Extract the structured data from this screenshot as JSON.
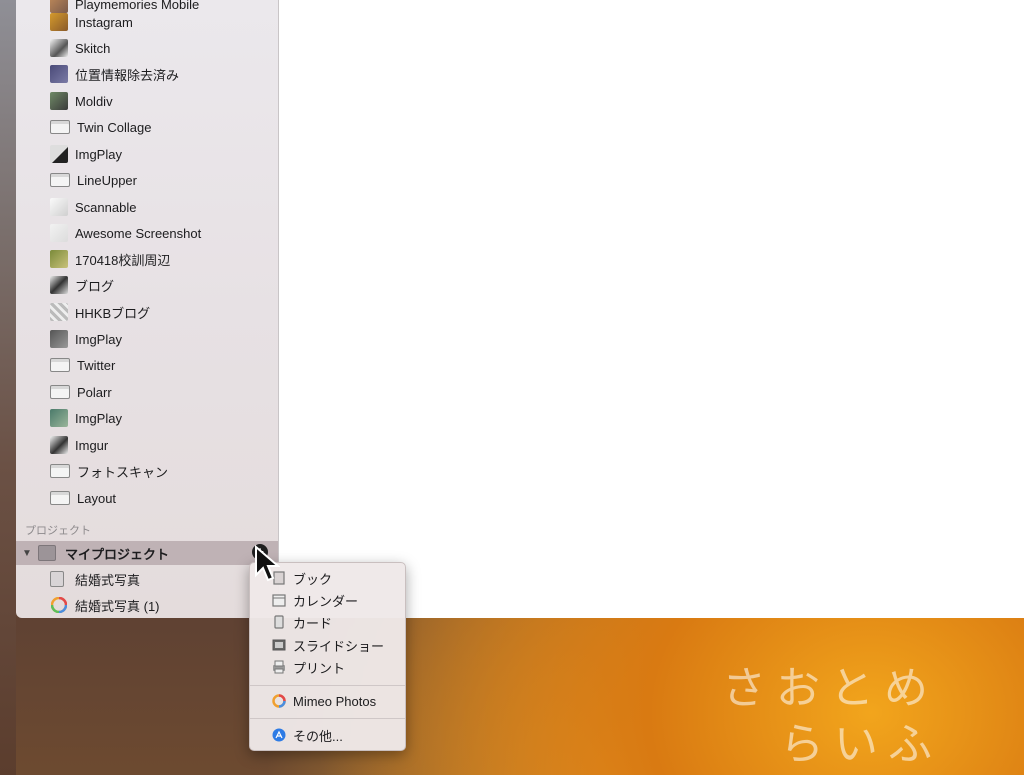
{
  "sidebar": {
    "items": [
      {
        "label": "Playmemories Mobile",
        "icon": "photo-thumbnail-icon",
        "kind": "photo"
      },
      {
        "label": "Instagram",
        "icon": "photo-thumbnail-icon",
        "kind": "photo"
      },
      {
        "label": "Skitch",
        "icon": "photo-thumbnail-icon",
        "kind": "photo"
      },
      {
        "label": "位置情報除去済み",
        "icon": "photo-thumbnail-icon",
        "kind": "photo"
      },
      {
        "label": "Moldiv",
        "icon": "photo-thumbnail-icon",
        "kind": "photo"
      },
      {
        "label": "Twin Collage",
        "icon": "album-icon",
        "kind": "album"
      },
      {
        "label": "ImgPlay",
        "icon": "photo-thumbnail-icon",
        "kind": "photo"
      },
      {
        "label": "LineUpper",
        "icon": "album-icon",
        "kind": "album"
      },
      {
        "label": "Scannable",
        "icon": "photo-thumbnail-icon",
        "kind": "photo"
      },
      {
        "label": "Awesome Screenshot",
        "icon": "photo-thumbnail-icon",
        "kind": "photo"
      },
      {
        "label": "170418校訓周辺",
        "icon": "photo-thumbnail-icon",
        "kind": "photo"
      },
      {
        "label": "ブログ",
        "icon": "photo-thumbnail-icon",
        "kind": "photo"
      },
      {
        "label": "HHKBブログ",
        "icon": "photo-thumbnail-icon",
        "kind": "photo"
      },
      {
        "label": "ImgPlay",
        "icon": "photo-thumbnail-icon",
        "kind": "photo"
      },
      {
        "label": "Twitter",
        "icon": "album-icon",
        "kind": "album"
      },
      {
        "label": "Polarr",
        "icon": "album-icon",
        "kind": "album"
      },
      {
        "label": "ImgPlay",
        "icon": "photo-thumbnail-icon",
        "kind": "photo"
      },
      {
        "label": "Imgur",
        "icon": "photo-thumbnail-icon",
        "kind": "photo"
      },
      {
        "label": "フォトスキャン",
        "icon": "album-icon",
        "kind": "album"
      },
      {
        "label": "Layout",
        "icon": "album-icon",
        "kind": "album"
      }
    ],
    "projects_header": "プロジェクト",
    "project_folder": {
      "label": "マイプロジェクト",
      "add_symbol": "+"
    },
    "project_items": [
      {
        "label": "結婚式写真",
        "icon": "book-icon"
      },
      {
        "label": "結婚式写真 (1)",
        "icon": "photos-app-icon"
      }
    ]
  },
  "context_menu": {
    "items": [
      {
        "label": "ブック",
        "icon": "book-icon"
      },
      {
        "label": "カレンダー",
        "icon": "calendar-icon"
      },
      {
        "label": "カード",
        "icon": "card-icon"
      },
      {
        "label": "スライドショー",
        "icon": "slideshow-icon"
      },
      {
        "label": "プリント",
        "icon": "print-icon"
      }
    ],
    "extension": {
      "label": "Mimeo Photos",
      "icon": "mimeo-icon"
    },
    "more": {
      "label": "その他...",
      "icon": "app-store-icon"
    }
  },
  "watermark": {
    "line1": "さおとめ",
    "line2": "らいふ"
  },
  "colors": {
    "selection": "#bfb2b5",
    "sidebar": "#e9e4e7",
    "menu": "#eee8e8"
  }
}
